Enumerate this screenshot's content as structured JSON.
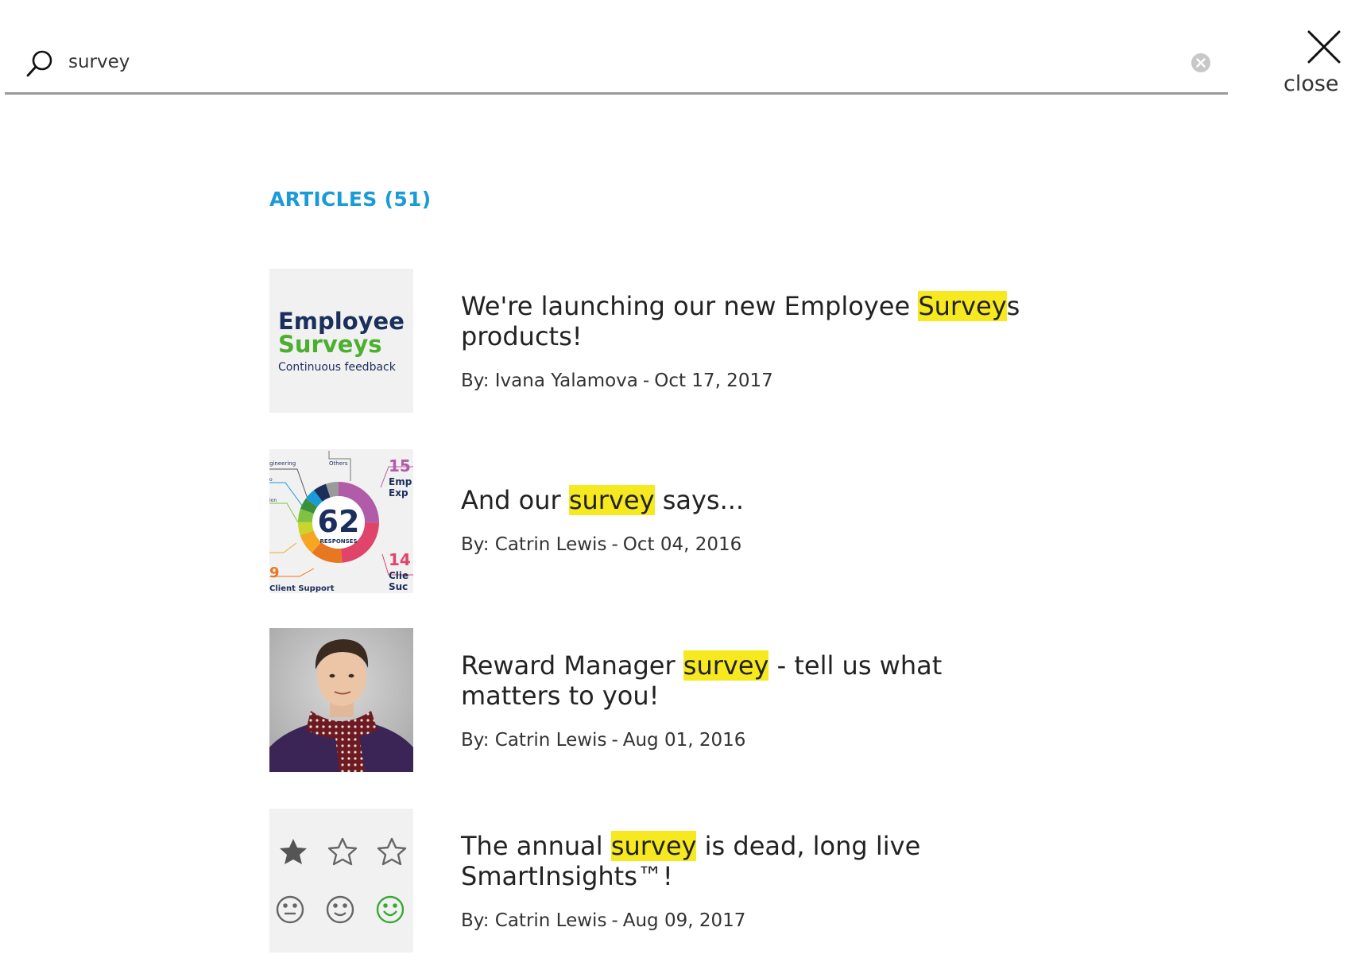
{
  "search": {
    "query": "survey",
    "icon": "search-icon",
    "clear_icon": "clear-icon"
  },
  "close": {
    "label": "close",
    "icon": "close-icon"
  },
  "section": {
    "heading": "ARTICLES (51)"
  },
  "colors": {
    "accent": "#1a9bd7",
    "highlight": "#f7e91f",
    "divider": "#9a9a9a"
  },
  "articles": [
    {
      "title_before": "We're launching our new Employee ",
      "title_match": "Survey",
      "title_after": "s products!",
      "author": "By: Ivana Yalamova",
      "separator": "-",
      "date": "Oct 17, 2017",
      "thumbnail": {
        "kind": "employee-surveys-logo",
        "line1": "Employee",
        "line2": "Surveys",
        "line3": "Continuous feedback"
      }
    },
    {
      "title_before": "And our ",
      "title_match": "survey",
      "title_after": " says...",
      "author": "By: Catrin Lewis",
      "separator": "-",
      "date": "Oct 04, 2016",
      "thumbnail": {
        "kind": "donut-infographic",
        "center_value": "62",
        "center_label": "RESPONSES",
        "top_right_value": "15",
        "top_right_label_1": "Emp",
        "top_right_label_2": "Exp",
        "bottom_right_value": "14",
        "bottom_right_label_1": "Clie",
        "bottom_right_label_2": "Suc",
        "bottom_left_value": "9",
        "bottom_left_label": "Client Support",
        "top_left_label": "gineering",
        "top_label": "Others",
        "left_label_1": "o",
        "left_label_2": "ion"
      }
    },
    {
      "title_before": "Reward Manager ",
      "title_match": "survey",
      "title_after": " - tell us what matters to you!",
      "author": "By: Catrin Lewis",
      "separator": "-",
      "date": "Aug 01, 2016",
      "thumbnail": {
        "kind": "person-photo"
      }
    },
    {
      "title_before": "The annual ",
      "title_match": "survey",
      "title_after": " is dead, long live SmartInsights™!",
      "author": "By: Catrin Lewis",
      "separator": "-",
      "date": "Aug 09, 2017",
      "thumbnail": {
        "kind": "rating-icons",
        "stars_filled": 1,
        "stars_total": 3
      }
    }
  ]
}
